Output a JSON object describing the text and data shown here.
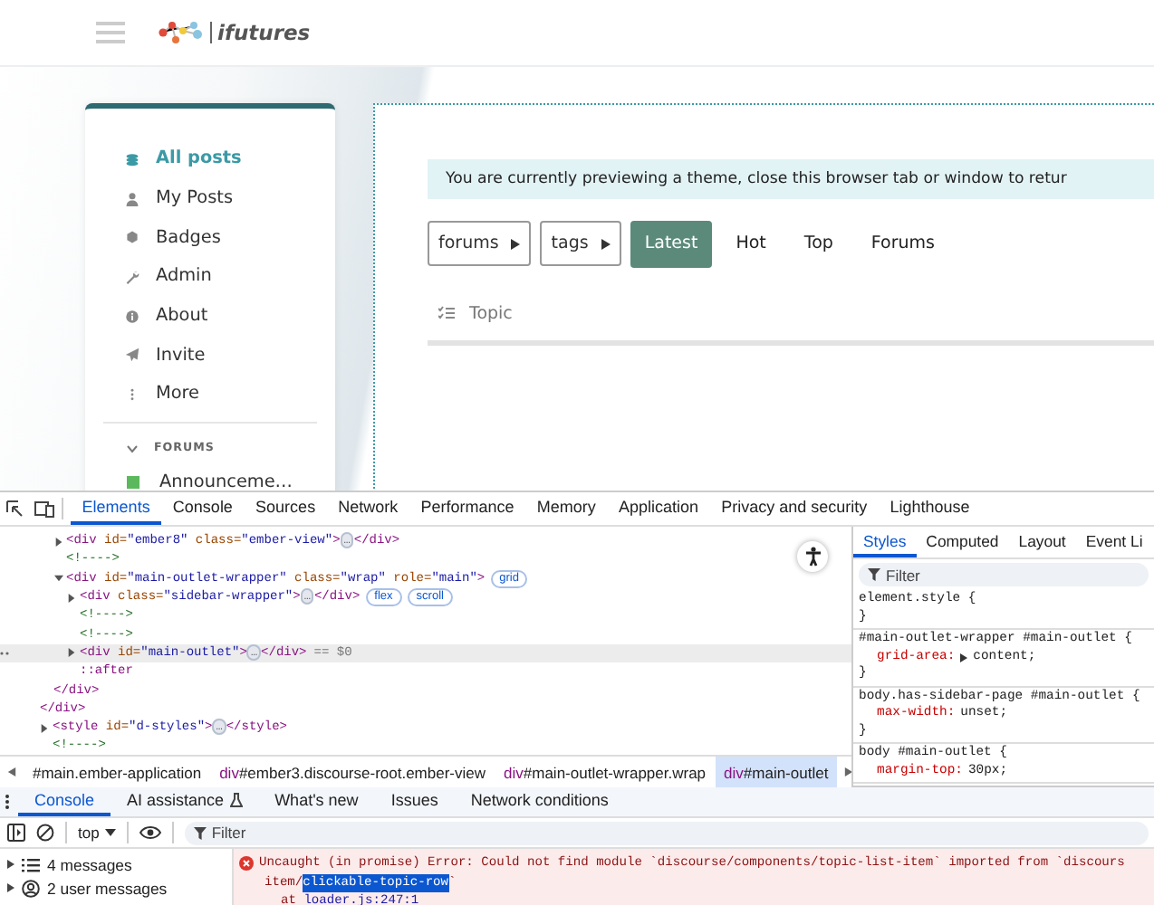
{
  "header": {
    "logo_text": "ifutures"
  },
  "sidebar": {
    "items": [
      {
        "label": "All posts",
        "kind": "all",
        "selected": true
      },
      {
        "label": "My Posts",
        "kind": "mine",
        "selected": false
      },
      {
        "label": "Badges",
        "kind": "badges",
        "selected": false
      },
      {
        "label": "Admin",
        "kind": "admin",
        "selected": false
      },
      {
        "label": "About",
        "kind": "about",
        "selected": false
      },
      {
        "label": "Invite",
        "kind": "invite",
        "selected": false
      },
      {
        "label": "More",
        "kind": "more",
        "selected": false
      }
    ],
    "section": {
      "title": "FORUMS",
      "expanded": true,
      "categories": [
        {
          "label": "Announceme…",
          "color": "#5cb85c"
        }
      ]
    }
  },
  "main": {
    "banner": "You are currently previewing a theme, close this browser tab or window to retur",
    "dropdowns": [
      {
        "label": "forums"
      },
      {
        "label": "tags"
      }
    ],
    "nav": [
      {
        "label": "Latest",
        "selected": true
      },
      {
        "label": "Hot",
        "selected": false
      },
      {
        "label": "Top",
        "selected": false
      },
      {
        "label": "Forums",
        "selected": false
      }
    ],
    "topic_header": "Topic"
  },
  "devtools": {
    "tabs": [
      {
        "label": "Elements",
        "selected": true
      },
      {
        "label": "Console",
        "selected": false
      },
      {
        "label": "Sources",
        "selected": false
      },
      {
        "label": "Network",
        "selected": false
      },
      {
        "label": "Performance",
        "selected": false
      },
      {
        "label": "Memory",
        "selected": false
      },
      {
        "label": "Application",
        "selected": false
      },
      {
        "label": "Privacy and security",
        "selected": false
      },
      {
        "label": "Lighthouse",
        "selected": false
      }
    ],
    "dom_tree": [
      {
        "children": [
          {
            "selected": false,
            "expanded": false,
            "tokens": [
              {
                "kind": "tag",
                "s": "<div"
              },
              {
                "kind": "attr",
                "s": " id="
              },
              {
                "kind": "value",
                "s": "\"ember8\""
              },
              {
                "kind": "attr",
                "s": " class="
              },
              {
                "kind": "value",
                "s": "\"ember-view\""
              },
              {
                "kind": "tag",
                "s": ">"
              },
              {
                "kind": "ellipsis",
                "s": "…"
              },
              {
                "kind": "tag",
                "s": "</div>"
              }
            ]
          },
          {
            "selected": false,
            "tokens": [
              {
                "kind": "comment",
                "s": "<!---->"
              }
            ]
          },
          {
            "selected": false,
            "expanded": true,
            "badges": [
              "grid"
            ],
            "tokens": [
              {
                "kind": "tag",
                "s": "<div"
              },
              {
                "kind": "attr",
                "s": " id="
              },
              {
                "kind": "value",
                "s": "\"main-outlet-wrapper\""
              },
              {
                "kind": "attr",
                "s": " class="
              },
              {
                "kind": "value",
                "s": "\"wrap\""
              },
              {
                "kind": "attr",
                "s": " role="
              },
              {
                "kind": "value",
                "s": "\"main\""
              },
              {
                "kind": "tag",
                "s": ">"
              }
            ],
            "children": [
              {
                "selected": false,
                "expanded": false,
                "badges": [
                  "flex",
                  "scroll"
                ],
                "tokens": [
                  {
                    "kind": "tag",
                    "s": "<div"
                  },
                  {
                    "kind": "attr",
                    "s": " class="
                  },
                  {
                    "kind": "value",
                    "s": "\"sidebar-wrapper\""
                  },
                  {
                    "kind": "tag",
                    "s": ">"
                  },
                  {
                    "kind": "ellipsis",
                    "s": "…"
                  },
                  {
                    "kind": "tag",
                    "s": "</div>"
                  }
                ]
              },
              {
                "selected": false,
                "tokens": [
                  {
                    "kind": "comment",
                    "s": "<!---->"
                  }
                ]
              },
              {
                "selected": false,
                "tokens": [
                  {
                    "kind": "comment",
                    "s": "<!---->"
                  }
                ]
              },
              {
                "selected": true,
                "expanded": false,
                "suffix": "== $0",
                "tokens": [
                  {
                    "kind": "tag",
                    "s": "<div"
                  },
                  {
                    "kind": "attr",
                    "s": " id="
                  },
                  {
                    "kind": "value",
                    "s": "\"main-outlet\""
                  },
                  {
                    "kind": "tag",
                    "s": ">"
                  },
                  {
                    "kind": "ellipsis",
                    "s": "…"
                  },
                  {
                    "kind": "tag",
                    "s": "</div>"
                  }
                ]
              },
              {
                "selected": false,
                "tokens": [
                  {
                    "kind": "pseudo",
                    "s": "::after"
                  }
                ]
              }
            ],
            "close": [
              {
                "kind": "tag",
                "s": "</div>"
              }
            ]
          }
        ],
        "close": [
          {
            "kind": "tag",
            "s": "</div>"
          }
        ]
      },
      {
        "selected": false,
        "expanded": false,
        "tokens": [
          {
            "kind": "tag",
            "s": "<style"
          },
          {
            "kind": "attr",
            "s": " id="
          },
          {
            "kind": "value",
            "s": "\"d-styles\""
          },
          {
            "kind": "tag",
            "s": ">"
          },
          {
            "kind": "ellipsis",
            "s": "…"
          },
          {
            "kind": "tag",
            "s": "</style>"
          }
        ]
      },
      {
        "selected": false,
        "tokens": [
          {
            "kind": "comment",
            "s": "<!---->"
          }
        ]
      }
    ],
    "breadcrumb": [
      {
        "text": "#main.ember-application",
        "selected": false
      },
      {
        "tag": "div",
        "text": "#ember3.discourse-root.ember-view",
        "selected": false
      },
      {
        "tag": "div",
        "text": "#main-outlet-wrapper.wrap",
        "selected": false
      },
      {
        "tag": "div",
        "text": "#main-outlet",
        "selected": true
      }
    ],
    "styles_panel": {
      "tabs": [
        {
          "label": "Styles",
          "selected": true
        },
        {
          "label": "Computed",
          "selected": false
        },
        {
          "label": "Layout",
          "selected": false
        },
        {
          "label": "Event Li",
          "selected": false
        }
      ],
      "filter_placeholder": "Filter",
      "rules": [
        {
          "selector": "element.style {",
          "close": "}"
        },
        {
          "selector": "#main-outlet-wrapper #main-outlet {",
          "declarations": [
            {
              "property": "grid-area:",
              "value": "content;",
              "expandable": true
            }
          ],
          "close": "}"
        },
        {
          "selector": "body.has-sidebar-page #main-outlet {",
          "declarations": [
            {
              "property": "max-width:",
              "value": "unset;",
              "expandable": false
            }
          ],
          "close": "}"
        },
        {
          "selector": "body #main-outlet {",
          "declarations": [
            {
              "property": "margin-top:",
              "value": "30px;",
              "expandable": false
            }
          ]
        }
      ]
    },
    "drawer": {
      "tabs": [
        {
          "label": "Console",
          "selected": true,
          "beta": false
        },
        {
          "label": "AI assistance",
          "selected": false,
          "beta": true
        },
        {
          "label": "What's new",
          "selected": false,
          "beta": false
        },
        {
          "label": "Issues",
          "selected": false,
          "beta": false
        },
        {
          "label": "Network conditions",
          "selected": false,
          "beta": false
        }
      ],
      "context": "top",
      "filter_placeholder": "Filter",
      "groups": [
        {
          "label": "4 messages",
          "kind": "all"
        },
        {
          "label": "2 user messages",
          "kind": "user"
        }
      ],
      "error": {
        "text": "Uncaught (in promise) Error: Could not find module `discourse/components/topic-list-item` imported from `discours",
        "continuation": "item/",
        "highlight": "clickable-topic-row",
        "tail": "`",
        "trace_prefix": "at",
        "trace_link": "loader.js:247:1"
      }
    }
  }
}
